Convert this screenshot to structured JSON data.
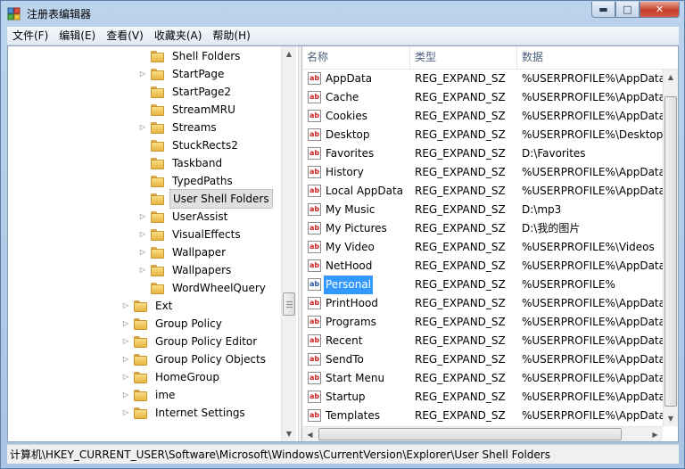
{
  "window": {
    "title": "注册表编辑器",
    "minimize_icon": "minimize-icon",
    "maximize_icon": "maximize-icon",
    "close_icon": "close-icon"
  },
  "menu": [
    "文件(F)",
    "编辑(E)",
    "查看(V)",
    "收藏夹(A)",
    "帮助(H)"
  ],
  "tree": {
    "children": [
      {
        "label": "Shell Folders",
        "expandable": false
      },
      {
        "label": "StartPage",
        "expandable": true
      },
      {
        "label": "StartPage2",
        "expandable": false
      },
      {
        "label": "StreamMRU",
        "expandable": false
      },
      {
        "label": "Streams",
        "expandable": true
      },
      {
        "label": "StuckRects2",
        "expandable": false
      },
      {
        "label": "Taskband",
        "expandable": false
      },
      {
        "label": "TypedPaths",
        "expandable": false
      },
      {
        "label": "User Shell Folders",
        "expandable": false,
        "selected": true
      },
      {
        "label": "UserAssist",
        "expandable": true
      },
      {
        "label": "VisualEffects",
        "expandable": true
      },
      {
        "label": "Wallpaper",
        "expandable": true
      },
      {
        "label": "Wallpapers",
        "expandable": true
      },
      {
        "label": "WordWheelQuery",
        "expandable": false
      }
    ],
    "siblings": [
      {
        "label": "Ext",
        "expandable": true
      },
      {
        "label": "Group Policy",
        "expandable": true
      },
      {
        "label": "Group Policy Editor",
        "expandable": true
      },
      {
        "label": "Group Policy Objects",
        "expandable": true
      },
      {
        "label": "HomeGroup",
        "expandable": true
      },
      {
        "label": "ime",
        "expandable": true
      },
      {
        "label": "Internet Settings",
        "expandable": true
      }
    ]
  },
  "list": {
    "columns": [
      "名称",
      "类型",
      "数据"
    ],
    "value_icon": "ab",
    "rows": [
      {
        "name": "AppData",
        "type": "REG_EXPAND_SZ",
        "data": "%USERPROFILE%\\AppData\\"
      },
      {
        "name": "Cache",
        "type": "REG_EXPAND_SZ",
        "data": "%USERPROFILE%\\AppData\\"
      },
      {
        "name": "Cookies",
        "type": "REG_EXPAND_SZ",
        "data": "%USERPROFILE%\\AppData\\"
      },
      {
        "name": "Desktop",
        "type": "REG_EXPAND_SZ",
        "data": "%USERPROFILE%\\Desktop"
      },
      {
        "name": "Favorites",
        "type": "REG_EXPAND_SZ",
        "data": "D:\\Favorites"
      },
      {
        "name": "History",
        "type": "REG_EXPAND_SZ",
        "data": "%USERPROFILE%\\AppData\\"
      },
      {
        "name": "Local AppData",
        "type": "REG_EXPAND_SZ",
        "data": "%USERPROFILE%\\AppData\\"
      },
      {
        "name": "My Music",
        "type": "REG_EXPAND_SZ",
        "data": "D:\\mp3"
      },
      {
        "name": "My Pictures",
        "type": "REG_EXPAND_SZ",
        "data": "D:\\我的图片"
      },
      {
        "name": "My Video",
        "type": "REG_EXPAND_SZ",
        "data": "%USERPROFILE%\\Videos"
      },
      {
        "name": "NetHood",
        "type": "REG_EXPAND_SZ",
        "data": "%USERPROFILE%\\AppData\\"
      },
      {
        "name": "Personal",
        "type": "REG_EXPAND_SZ",
        "data": "%USERPROFILE%",
        "selected": true
      },
      {
        "name": "PrintHood",
        "type": "REG_EXPAND_SZ",
        "data": "%USERPROFILE%\\AppData\\"
      },
      {
        "name": "Programs",
        "type": "REG_EXPAND_SZ",
        "data": "%USERPROFILE%\\AppData\\"
      },
      {
        "name": "Recent",
        "type": "REG_EXPAND_SZ",
        "data": "%USERPROFILE%\\AppData\\"
      },
      {
        "name": "SendTo",
        "type": "REG_EXPAND_SZ",
        "data": "%USERPROFILE%\\AppData\\"
      },
      {
        "name": "Start Menu",
        "type": "REG_EXPAND_SZ",
        "data": "%USERPROFILE%\\AppData\\"
      },
      {
        "name": "Startup",
        "type": "REG_EXPAND_SZ",
        "data": "%USERPROFILE%\\AppData\\"
      },
      {
        "name": "Templates",
        "type": "REG_EXPAND_SZ",
        "data": "%USERPROFILE%\\AppData\\"
      }
    ]
  },
  "status": {
    "path": "计算机\\HKEY_CURRENT_USER\\Software\\Microsoft\\Windows\\CurrentVersion\\Explorer\\User Shell Folders"
  }
}
